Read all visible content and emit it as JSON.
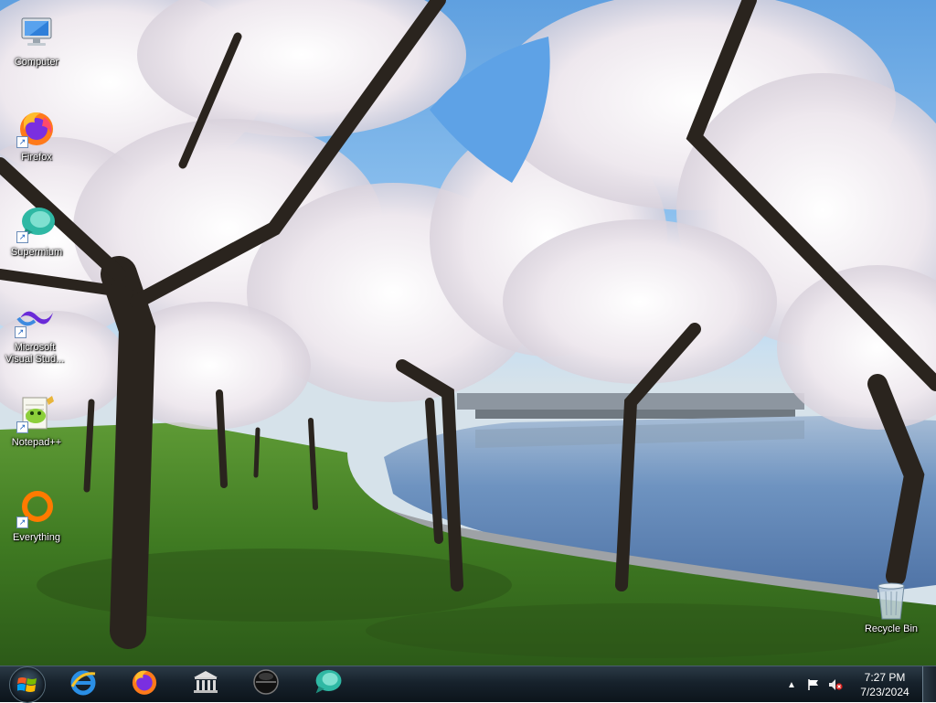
{
  "desktop": {
    "icons": [
      {
        "label": "Computer",
        "icon": "computer-icon",
        "shortcut": false
      },
      {
        "label": "Firefox",
        "icon": "firefox-icon",
        "shortcut": true
      },
      {
        "label": "Supermium",
        "icon": "supermium-icon",
        "shortcut": true
      },
      {
        "label": "Microsoft Visual Stud...",
        "icon": "visual-studio-icon",
        "shortcut": true
      },
      {
        "label": "Notepad++",
        "icon": "notepad-plus-plus-icon",
        "shortcut": true
      },
      {
        "label": "Everything",
        "icon": "everything-search-icon",
        "shortcut": true
      },
      {
        "label": "Recycle Bin",
        "icon": "recycle-bin-icon",
        "shortcut": false
      }
    ]
  },
  "taskbar": {
    "start": {
      "icon": "windows-logo-icon"
    },
    "pinned": [
      {
        "icon": "internet-explorer-icon"
      },
      {
        "icon": "firefox-icon"
      },
      {
        "icon": "library-icon"
      },
      {
        "icon": "dark-orb-icon"
      },
      {
        "icon": "supermium-icon"
      }
    ],
    "tray": {
      "icons": [
        "show-hidden-icons-icon",
        "action-center-flag-icon",
        "volume-muted-icon"
      ],
      "time": "7:27 PM",
      "date": "7/23/2024"
    }
  },
  "colors": {
    "taskbar": "#17222c",
    "sky": "#5fa0e0",
    "grass": "#3f7a22",
    "water": "#6e93c0",
    "blossom": "#f2eef2"
  }
}
